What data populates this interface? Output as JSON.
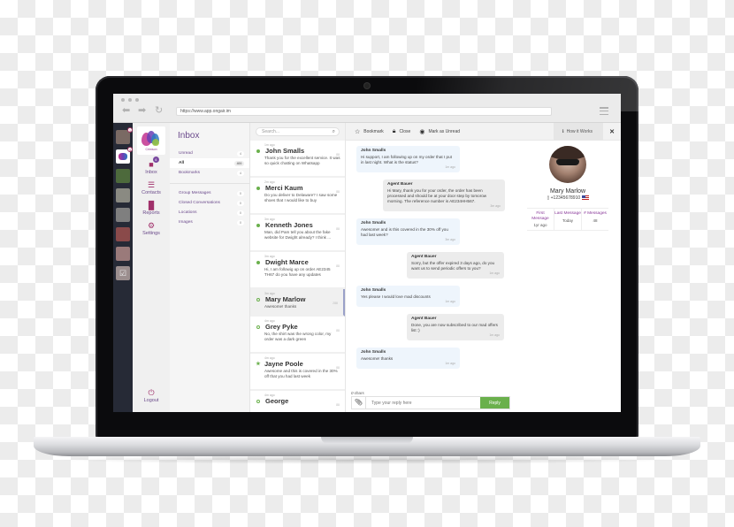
{
  "browser": {
    "url": "https://www.app.ongair.im",
    "back_icon": "arrow-left-icon",
    "forward_icon": "arrow-right-icon",
    "reload_icon": "reload-icon",
    "menu_icon": "hamburger-icon"
  },
  "dock": {
    "apps": [
      {
        "label": "app-1",
        "badge": "1"
      },
      {
        "label": "Crimson",
        "badge": "4",
        "active": true
      },
      {
        "label": "app-3",
        "badge": ""
      },
      {
        "label": "app-4",
        "badge": ""
      },
      {
        "label": "app-5",
        "badge": ""
      },
      {
        "label": "app-6",
        "badge": ""
      },
      {
        "label": "app-7",
        "badge": ""
      },
      {
        "label": "app-8",
        "badge": ""
      }
    ]
  },
  "nav": {
    "logo_text": "Crimson",
    "items": [
      {
        "label": "Inbox",
        "icon": "chat-icon",
        "badge": "4"
      },
      {
        "label": "Contacts",
        "icon": "contacts-icon"
      },
      {
        "label": "Reports",
        "icon": "bar-chart-icon"
      },
      {
        "label": "Settings",
        "icon": "settings-icon"
      }
    ],
    "logout_label": "Logout"
  },
  "folders": {
    "title": "Inbox",
    "primary": [
      {
        "label": "Unread",
        "count": "4"
      },
      {
        "label": "All",
        "count": "400",
        "active": true
      },
      {
        "label": "Bookmarks",
        "count": "4"
      }
    ],
    "secondary": [
      {
        "label": "Group Messages",
        "count": "0"
      },
      {
        "label": "Closed Conversations",
        "count": "0"
      },
      {
        "label": "Locations",
        "count": "0"
      },
      {
        "label": "Images",
        "count": "0"
      }
    ]
  },
  "conversations": {
    "search_placeholder": "Search...",
    "items": [
      {
        "time": "1m ago",
        "name": "John Smalls",
        "preview": "Thank you for the excellent service. It was so quick chatting on Whatsapp",
        "status": "unread",
        "tag": "88"
      },
      {
        "time": "2m ago",
        "name": "Merci Kaum",
        "preview": "Do you deliver to Delaware? I saw some shoes that I would like to buy",
        "status": "unread",
        "tag": "88"
      },
      {
        "time": "3m ago",
        "name": "Kenneth Jones",
        "preview": "Man, did Pam tell you about the fake website for Dwight already? I think ...",
        "status": "unread",
        "tag": "88"
      },
      {
        "time": "3m ago",
        "name": "Dwight Marce",
        "preview": "Hi, I am followig up on order AE2345 TH67 do you have any updates",
        "status": "unread",
        "tag": "88"
      },
      {
        "time": "3m ago",
        "name": "Mary Marlow",
        "preview": "Awesome! thanks",
        "status": "read",
        "tag": "288",
        "selected": true
      },
      {
        "time": "4m ago",
        "name": "Grey Pyke",
        "preview": "No, the shirt was the wrong color, my order was a dark green",
        "status": "read",
        "tag": "88"
      },
      {
        "time": "4m ago",
        "name": "Jayne Poole",
        "preview": "Awesome and this is covered in the 30% off that you had last week",
        "status": "starred",
        "tag": "88"
      },
      {
        "time": "4m ago",
        "name": "George",
        "preview": "",
        "status": "read",
        "tag": "88"
      }
    ]
  },
  "toolbar": {
    "bookmark_label": "Bookmark",
    "close_label": "Close",
    "mark_unread_label": "Mark as Unread",
    "how_it_works_label": "How it Works",
    "close_icon": "close-icon"
  },
  "chat": {
    "messages": [
      {
        "sender": "John Smalls",
        "text": "Hi support, I am following up on my order that I put in last night. What is the status?",
        "time": "1m ago",
        "direction": "in"
      },
      {
        "sender": "Agent Bauer",
        "text": "Hi Mary, thank you for your order, the order has been processed and should be at your door step by tomorow morning. The reference number is AE234HH567.",
        "time": "3m ago",
        "direction": "out"
      },
      {
        "sender": "John Smalls",
        "text": "Awesome! and is this covered in the 30% off you had last week?",
        "time": "3m ago",
        "direction": "in"
      },
      {
        "sender": "Agent Bauer",
        "text": "Sorry, but the offer expired 3 days ago, do you want us to send periodic offers to you?",
        "time": "1m ago",
        "direction": "out"
      },
      {
        "sender": "John Smalls",
        "text": "Yes please I would love mad discounts",
        "time": "1m ago",
        "direction": "in"
      },
      {
        "sender": "Agent Bauer",
        "text": "Done, you are now subscribed to our mad offers list :)",
        "time": "1m ago",
        "direction": "out"
      },
      {
        "sender": "John Smalls",
        "text": "Awesome! thanks",
        "time": "1m ago",
        "direction": "in"
      }
    ],
    "char_count": "0 chars",
    "reply_placeholder": "Type your reply here",
    "reply_button": "Reply"
  },
  "profile": {
    "name": "Mary Marlow",
    "phone": "+12345678910",
    "country_flag": "us-flag-icon",
    "stats": [
      {
        "label": "First Message",
        "value": "1yr ago"
      },
      {
        "label": "Last Message",
        "value": "Today"
      },
      {
        "label": "# Messages",
        "value": "48"
      }
    ]
  },
  "colors": {
    "accent_purple": "#6b4a8c",
    "accent_magenta": "#a0306a",
    "reply_green": "#6ab04c",
    "dock_bg": "#262a36"
  }
}
